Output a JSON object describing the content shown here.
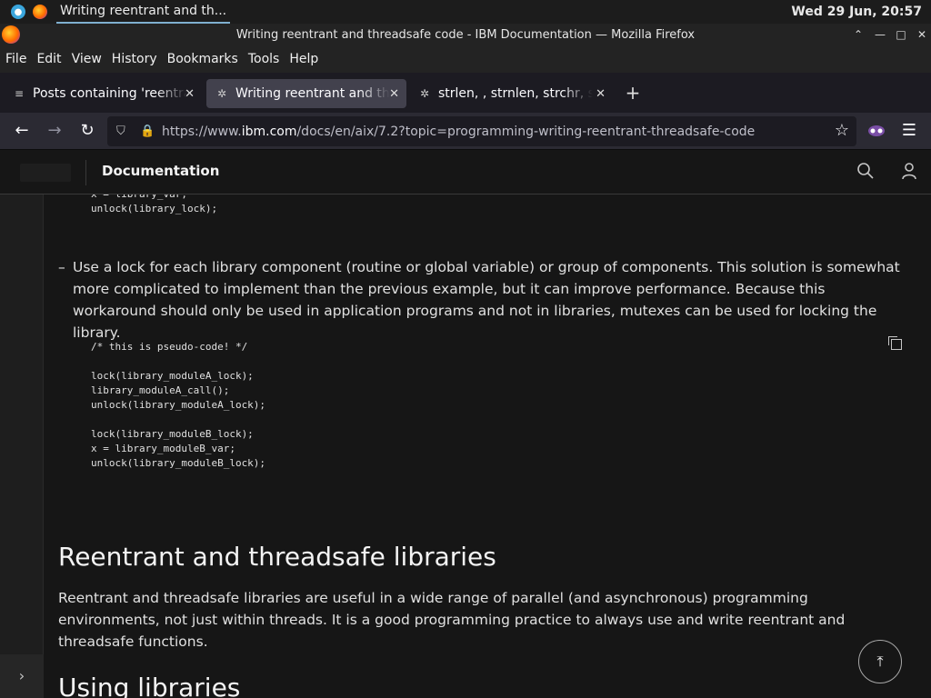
{
  "system": {
    "task_label": "Writing reentrant and th...",
    "clock": "Wed 29 Jun, 20:57"
  },
  "window": {
    "title": "Writing reentrant and threadsafe code - IBM Documentation — Mozilla Firefox",
    "controls": {
      "up": "⌃",
      "minimize": "—",
      "maximize": "□",
      "close": "✕"
    }
  },
  "menubar": {
    "items": [
      "File",
      "Edit",
      "View",
      "History",
      "Bookmarks",
      "Tools",
      "Help"
    ]
  },
  "tabs": [
    {
      "label": "Posts containing 'reentrant'",
      "favicon": "stackoverflow-icon",
      "active": false
    },
    {
      "label": "Writing reentrant and threadsafe",
      "favicon": "ibm-icon",
      "active": true
    },
    {
      "label": "strlen, , strnlen, strchr, strrchr",
      "favicon": "ibm-icon",
      "active": false
    }
  ],
  "tab_close": "✕",
  "new_tab": "+",
  "navbar": {
    "url_prefix": "https://www.",
    "url_domain": "ibm.com",
    "url_rest": "/docs/en/aix/7.2?topic=programming-writing-reentrant-threadsafe-code"
  },
  "header": {
    "title": "Documentation"
  },
  "content": {
    "code_top": "x = library_var;\nunlock(library_lock);",
    "bullet_dash": "–",
    "bullet_text": "Use a lock for each library component (routine or global variable) or group of components. This solution is somewhat more complicated to implement than the previous example, but it can improve performance. Because this workaround should only be used in application programs and not in libraries, mutexes can be used for locking the library.",
    "code_block": "/* this is pseudo-code! */\n\nlock(library_moduleA_lock);\nlibrary_moduleA_call();\nunlock(library_moduleA_lock);\n\nlock(library_moduleB_lock);\nx = library_moduleB_var;\nunlock(library_moduleB_lock);",
    "heading_libraries": "Reentrant and threadsafe libraries",
    "para_libraries": "Reentrant and threadsafe libraries are useful in a wide range of parallel (and asynchronous) programming environments, not just within threads. It is a good programming practice to always use and write reentrant and threadsafe functions.",
    "heading_using": "Using libraries"
  },
  "icons": {
    "back": "←",
    "forward": "→",
    "reload": "↻",
    "shield": "⛉",
    "lock": "🔒",
    "star": "☆",
    "menu": "☰",
    "search": "⚲",
    "user": "👤",
    "chevron_right": "›",
    "to_top": "⤒"
  },
  "colors": {
    "page_bg": "#161616",
    "tab_active": "#42414d",
    "navbar_bg": "#2b2a33"
  }
}
